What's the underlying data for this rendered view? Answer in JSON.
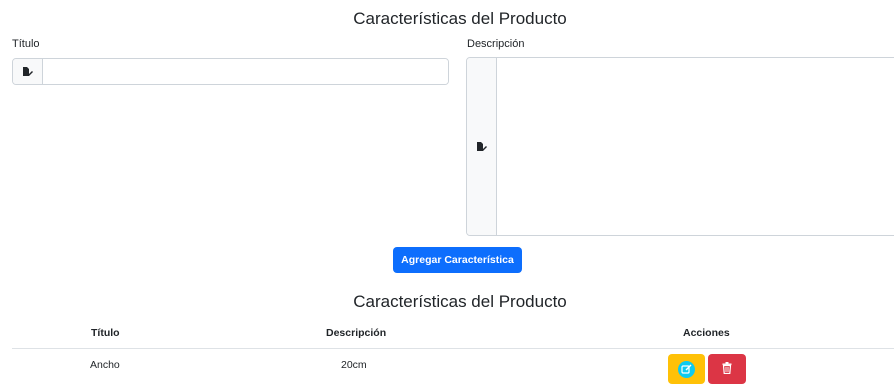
{
  "form": {
    "title": "Características del Producto",
    "titulo_label": "Título",
    "titulo_value": "",
    "descripcion_label": "Descripción",
    "descripcion_value": "",
    "add_button_label": "Agregar Característica"
  },
  "table": {
    "title": "Características del Producto",
    "headers": [
      "Título",
      "Descripción",
      "Acciones"
    ],
    "rows": [
      {
        "titulo": "Ancho",
        "descripcion": "20cm"
      }
    ]
  },
  "icons": {
    "input_addon": "edit-document-icon",
    "edit": "edit-icon",
    "delete": "trash-icon"
  },
  "colors": {
    "primary": "#0d6efd",
    "warning": "#ffc107",
    "danger": "#dc3545",
    "info": "#0dcaf0"
  }
}
